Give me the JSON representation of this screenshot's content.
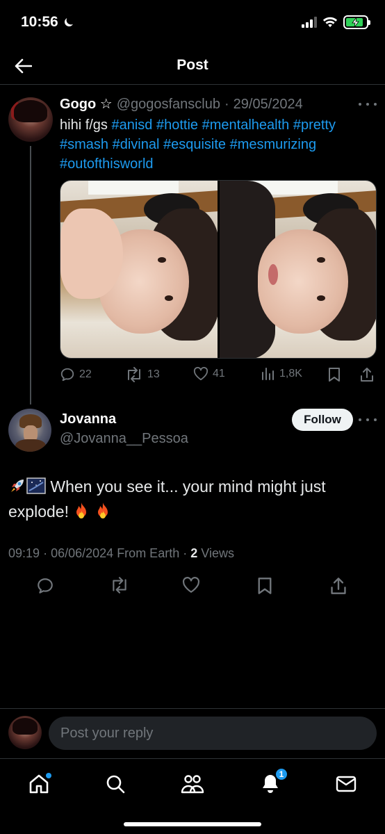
{
  "status_bar": {
    "time": "10:56",
    "battery_color": "#30d158"
  },
  "header": {
    "title": "Post"
  },
  "quoted_post": {
    "name": "Gogo ☆",
    "handle": "@gogosfansclub",
    "separator": "·",
    "date": "29/05/2024",
    "text_prefix": "hihi f/gs ",
    "hashtags": [
      "#anisd",
      "#hottie",
      "#mentalhealth",
      "#pretty",
      "#smash",
      "#divinal",
      "#esquisite",
      "#mesmurizing",
      "#outofthisworld"
    ],
    "stats": {
      "replies": "22",
      "reposts": "13",
      "likes": "41",
      "views": "1,8K"
    }
  },
  "main_post": {
    "name": "Jovanna",
    "handle": "@Jovanna__Pessoa",
    "follow_label": "Follow",
    "text_line1": "When you see it... your mind might just",
    "text_line2": "explode!",
    "emoji_start": [
      "rocket-emoji",
      "night-sky-emoji"
    ],
    "emoji_end": [
      "fire-emoji",
      "fire-emoji"
    ],
    "meta_time": "09:19",
    "meta_sep": "·",
    "meta_date": "06/06/2024",
    "meta_source": "From Earth",
    "meta_sep2": "·",
    "views_count": "2",
    "views_label": "Views"
  },
  "reply": {
    "placeholder": "Post your reply"
  },
  "bottom_nav": {
    "items": [
      "home-icon",
      "search-icon",
      "communities-icon",
      "notifications-icon",
      "messages-icon"
    ],
    "notification_count": "1"
  },
  "colors": {
    "accent": "#1d9bf0",
    "background": "#000000",
    "muted": "#71767b"
  }
}
